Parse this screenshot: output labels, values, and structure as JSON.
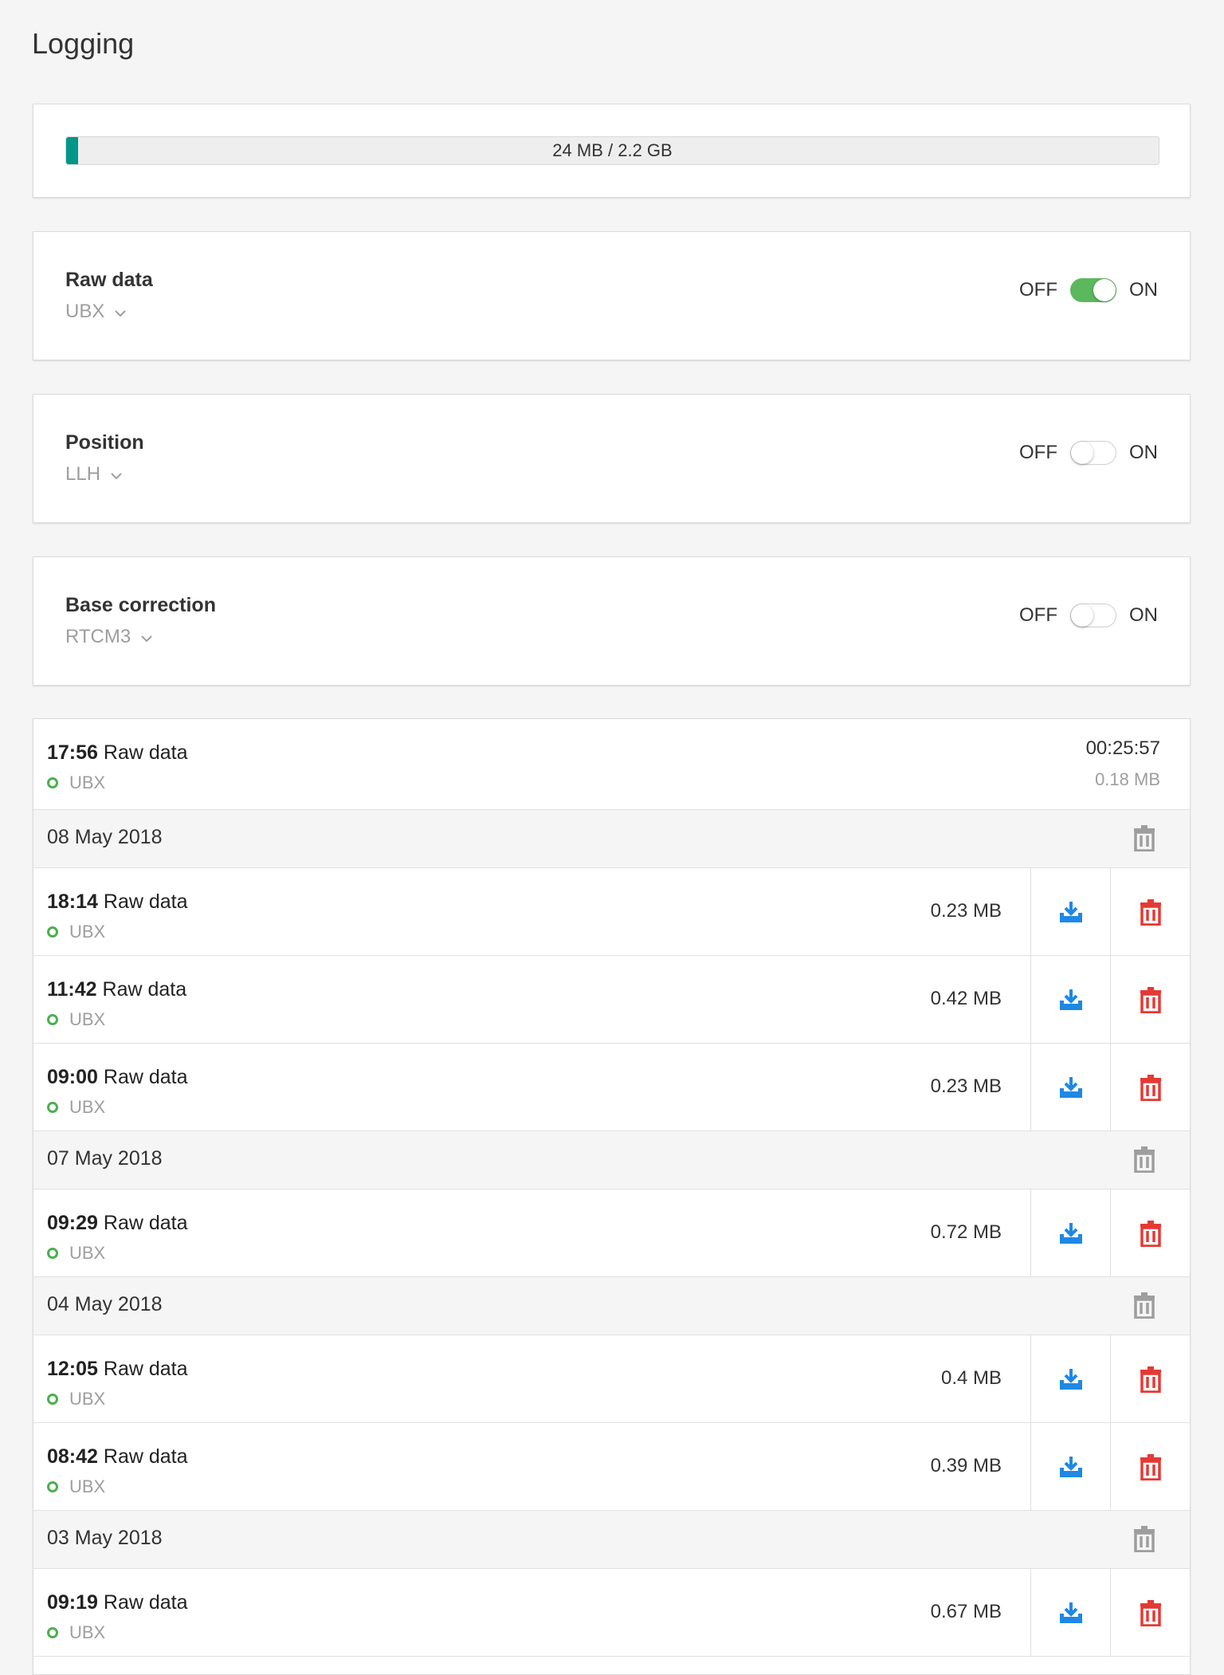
{
  "page": {
    "title": "Logging"
  },
  "storage": {
    "label": "24 MB / 2.2 GB",
    "used_fraction": 0.011,
    "fill_color": "#009688"
  },
  "toggle_labels": {
    "off": "OFF",
    "on": "ON"
  },
  "settings": [
    {
      "name": "Raw data",
      "format": "UBX",
      "enabled": true
    },
    {
      "name": "Position",
      "format": "LLH",
      "enabled": false
    },
    {
      "name": "Base correction",
      "format": "RTCM3",
      "enabled": false
    }
  ],
  "current_log": {
    "time": "17:56",
    "type": "Raw data",
    "format": "UBX",
    "duration": "00:25:57",
    "size": "0.18 MB"
  },
  "log_groups": [
    {
      "date": "08 May 2018",
      "files": [
        {
          "time": "18:14",
          "type": "Raw data",
          "format": "UBX",
          "size": "0.23 MB"
        },
        {
          "time": "11:42",
          "type": "Raw data",
          "format": "UBX",
          "size": "0.42 MB"
        },
        {
          "time": "09:00",
          "type": "Raw data",
          "format": "UBX",
          "size": "0.23 MB"
        }
      ]
    },
    {
      "date": "07 May 2018",
      "files": [
        {
          "time": "09:29",
          "type": "Raw data",
          "format": "UBX",
          "size": "0.72 MB"
        }
      ]
    },
    {
      "date": "04 May 2018",
      "files": [
        {
          "time": "12:05",
          "type": "Raw data",
          "format": "UBX",
          "size": "0.4 MB"
        },
        {
          "time": "08:42",
          "type": "Raw data",
          "format": "UBX",
          "size": "0.39 MB"
        }
      ]
    },
    {
      "date": "03 May 2018",
      "files": [
        {
          "time": "09:19",
          "type": "Raw data",
          "format": "UBX",
          "size": "0.67 MB"
        }
      ]
    }
  ],
  "colors": {
    "toggle_on": "#5cb85c",
    "status_dot": "#4caf50",
    "download_icon": "#1e88e5",
    "delete_icon": "#e53935",
    "group_delete_icon": "#9e9e9e"
  },
  "icons": {
    "download": "download-icon",
    "delete": "trash-icon",
    "group_delete": "trash-icon",
    "dropdown": "chevron-down-icon",
    "status": "circle-icon"
  }
}
